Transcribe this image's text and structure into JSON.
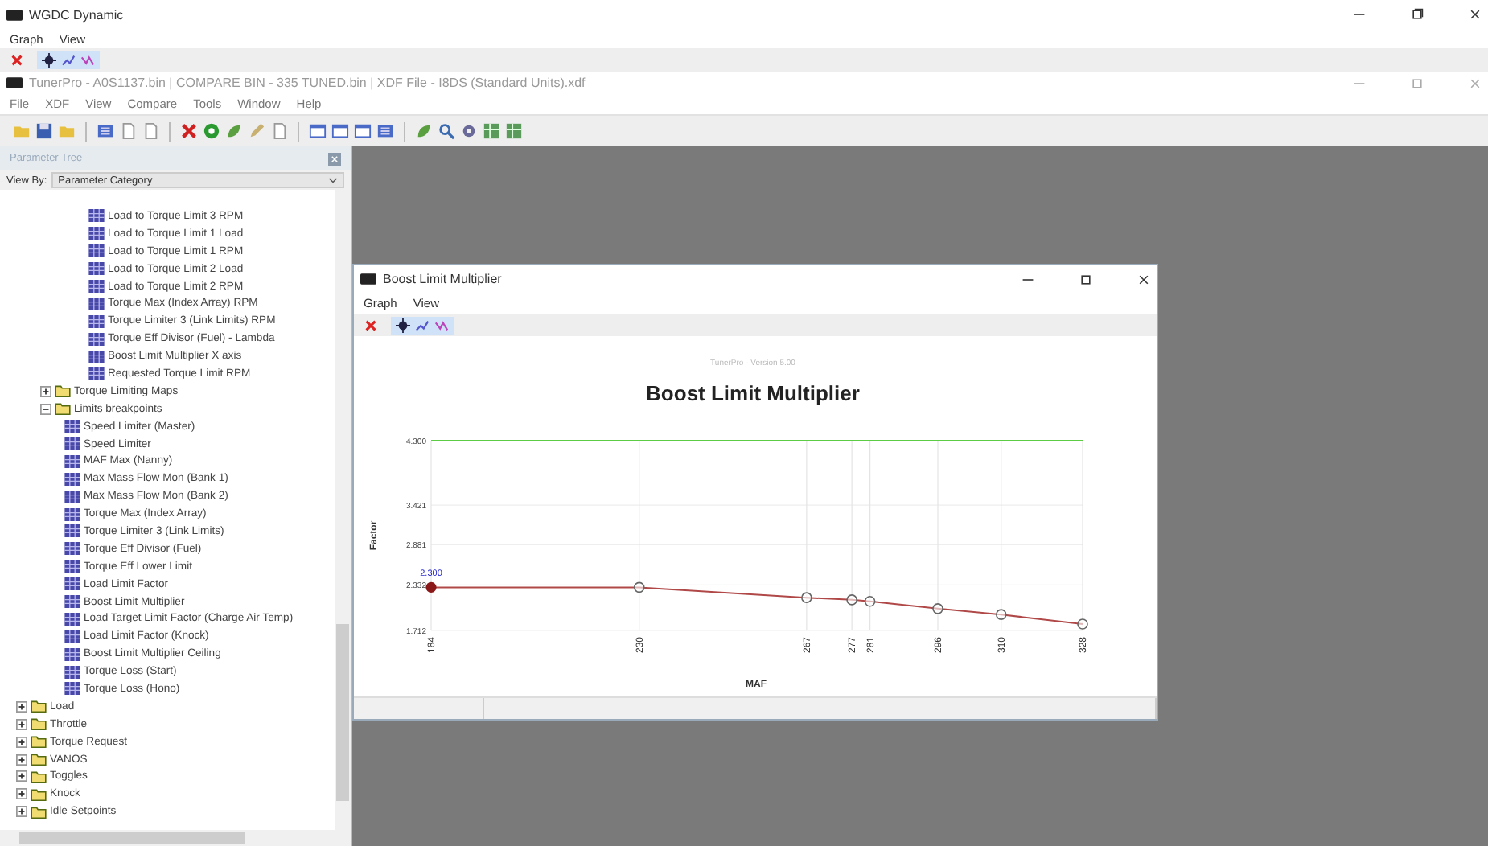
{
  "wgdc_window": {
    "title": "WGDC Dynamic",
    "menu": [
      "Graph",
      "View"
    ]
  },
  "main_window": {
    "title": "TunerPro - A0S1137.bin | COMPARE BIN - 335 TUNED.bin | XDF File - I8DS (Standard Units).xdf",
    "menu": [
      "File",
      "XDF",
      "View",
      "Compare",
      "Tools",
      "Window",
      "Help"
    ]
  },
  "parameter_tree": {
    "title": "Parameter Tree",
    "view_by_label": "View By:",
    "view_by_value": "Parameter Category",
    "items": [
      {
        "children": [
          {
            "children": [
              {
                "children": [
                  {
                    "label": "Load to Torque Limit 3 RPM",
                    "kind": "table"
                  },
                  {
                    "label": "Load to Torque Limit 1 Load",
                    "kind": "table"
                  },
                  {
                    "label": "Load to Torque Limit 1 RPM",
                    "kind": "table"
                  },
                  {
                    "label": "Load to Torque Limit 2 Load",
                    "kind": "table"
                  },
                  {
                    "label": "Load to Torque Limit 2 RPM",
                    "kind": "table"
                  },
                  {
                    "label": "Torque Max (Index Array) RPM",
                    "kind": "table"
                  },
                  {
                    "label": "Torque Limiter 3 (Link Limits) RPM",
                    "kind": "table"
                  },
                  {
                    "label": "Torque Eff Divisor (Fuel) - Lambda",
                    "kind": "table"
                  },
                  {
                    "label": "Boost Limit Multiplier X axis",
                    "kind": "table"
                  },
                  {
                    "label": "Requested Torque Limit RPM",
                    "kind": "table"
                  }
                ]
              }
            ]
          },
          {
            "label": "Torque Limiting Maps",
            "kind": "folder",
            "expanded": false
          },
          {
            "label": "Limits breakpoints",
            "kind": "folder",
            "expanded": true,
            "children": [
              {
                "label": "Speed Limiter (Master)",
                "kind": "table"
              },
              {
                "label": "Speed Limiter",
                "kind": "table"
              },
              {
                "label": "MAF Max (Nanny)",
                "kind": "table"
              },
              {
                "label": "Max Mass Flow Mon (Bank 1)",
                "kind": "table"
              },
              {
                "label": "Max Mass Flow Mon (Bank 2)",
                "kind": "table"
              },
              {
                "label": "Torque Max (Index Array)",
                "kind": "table"
              },
              {
                "label": "Torque Limiter 3 (Link Limits)",
                "kind": "table"
              },
              {
                "label": "Torque Eff Divisor (Fuel)",
                "kind": "table"
              },
              {
                "label": "Torque Eff Lower Limit",
                "kind": "table"
              },
              {
                "label": "Load Limit Factor",
                "kind": "table"
              },
              {
                "label": "Boost Limit Multiplier",
                "kind": "table"
              },
              {
                "label": "Load Target Limit Factor (Charge Air Temp)",
                "kind": "table"
              },
              {
                "label": "Load Limit Factor (Knock)",
                "kind": "table"
              },
              {
                "label": "Boost Limit Multiplier Ceiling",
                "kind": "table"
              },
              {
                "label": "Torque Loss (Start)",
                "kind": "table"
              },
              {
                "label": "Torque Loss (Hono)",
                "kind": "table"
              }
            ]
          }
        ]
      },
      {
        "label": "Load",
        "kind": "folder",
        "expanded": false
      },
      {
        "label": "Throttle",
        "kind": "folder",
        "expanded": false
      },
      {
        "label": "Torque Request",
        "kind": "folder",
        "expanded": false
      },
      {
        "label": "VANOS",
        "kind": "folder",
        "expanded": false
      },
      {
        "label": "Toggles",
        "kind": "folder",
        "expanded": false
      },
      {
        "label": "Knock",
        "kind": "folder",
        "expanded": false
      },
      {
        "label": "Idle Setpoints",
        "kind": "folder",
        "expanded": false
      }
    ]
  },
  "graph_window": {
    "title": "Boost Limit Multiplier",
    "menu": [
      "Graph",
      "View"
    ],
    "caption": "TunerPro - Version 5.00",
    "chart_data": {
      "type": "line",
      "title": "Boost Limit Multiplier",
      "xlabel": "MAF",
      "ylabel": "Factor",
      "x": [
        184,
        230,
        267,
        277,
        281,
        296,
        310,
        328
      ],
      "series": [
        {
          "color": "#b04848",
          "marker": "circle",
          "values": [
            2.3,
            2.3,
            2.16,
            2.13,
            2.11,
            2.01,
            1.93,
            1.8
          ]
        }
      ],
      "grid": true,
      "xlim": [
        184,
        328
      ],
      "ylim": [
        1.712,
        4.3
      ],
      "xticks": [
        184,
        230,
        267,
        277,
        281,
        296,
        310,
        328
      ],
      "yticks": [
        {
          "value": 1.712,
          "label": "1.712"
        },
        {
          "value": 2.332,
          "label": "2.332"
        },
        {
          "value": 2.881,
          "label": "2.881"
        },
        {
          "value": 3.421,
          "label": "3.421"
        },
        {
          "value": 4.3,
          "label": "4.300"
        }
      ],
      "annotations": [
        {
          "x": 184,
          "y": 2.3,
          "text": "2.300"
        }
      ],
      "ref_lines": [
        {
          "axis": "y",
          "value": 4.3,
          "color": "#5ccc44"
        }
      ]
    }
  }
}
